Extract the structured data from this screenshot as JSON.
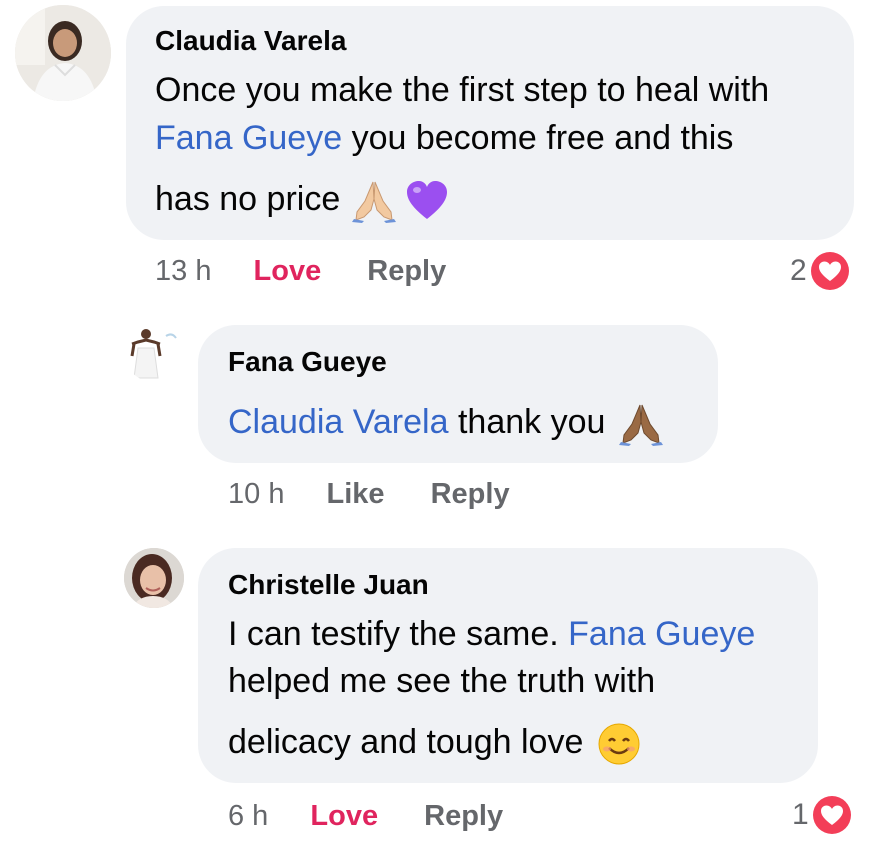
{
  "comments": [
    {
      "author": "Claudia Varela",
      "line1": "Once you make the first step to heal with",
      "mention1": "Fana Gueye",
      "line2_rest": " you become free and this",
      "line3": "has no price",
      "time": "13 h",
      "reaction_action": "Love",
      "reply": "Reply",
      "reaction_count": "2"
    },
    {
      "author": "Fana Gueye",
      "mention": "Claudia Varela",
      "text_rest": " thank you",
      "time": "10 h",
      "reaction_action": "Like",
      "reply": "Reply"
    },
    {
      "author": "Christelle Juan",
      "line1_start": "I can testify the same. ",
      "mention": "Fana Gueye",
      "line2": "helped me see the truth with",
      "line3": "delicacy and tough love",
      "time": "6 h",
      "reaction_action": "Love",
      "reply": "Reply",
      "reaction_count": "1"
    }
  ],
  "colors": {
    "bubble": "#f0f2f5",
    "mention": "#3566c8",
    "love": "#e0245e",
    "meta": "#65676b",
    "heart": "#f33e58"
  },
  "icons": [
    "folded-hands-icon",
    "purple-heart-icon",
    "smiling-face-icon",
    "love-reaction-icon"
  ]
}
